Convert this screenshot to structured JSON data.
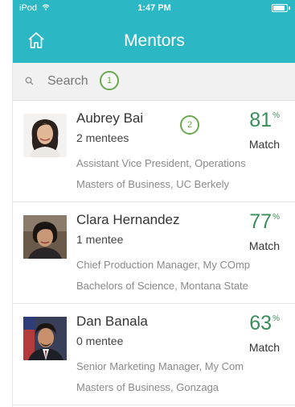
{
  "status_bar": {
    "carrier": "iPod",
    "time": "1:47 PM",
    "battery_level": 0.8
  },
  "nav": {
    "title": "Mentors",
    "home_icon": "home-icon"
  },
  "search": {
    "placeholder": "Search"
  },
  "markers": {
    "first": "1",
    "second": "2"
  },
  "mentors": [
    {
      "name": "Aubrey Bai",
      "mentees": "2 mentees",
      "match": "81",
      "match_unit": "%",
      "match_label": "Match",
      "title": "Assistant Vice President, Operations",
      "education": "Masters of Business, UC Berkely"
    },
    {
      "name": "Clara Hernandez",
      "mentees": "1 mentee",
      "match": "77",
      "match_unit": "%",
      "match_label": "Match",
      "title": "Chief Production Manager, My COmp",
      "education": "Bachelors of Science, Montana State"
    },
    {
      "name": "Dan Banala",
      "mentees": "0 mentee",
      "match": "63",
      "match_unit": "%",
      "match_label": "Match",
      "title": "Senior Marketing Manager, My Com",
      "education": "Masters of Business, Gonzaga"
    }
  ],
  "colors": {
    "accent": "#2bb7c4",
    "match": "#3a8d5a",
    "marker": "#6aa84f"
  }
}
